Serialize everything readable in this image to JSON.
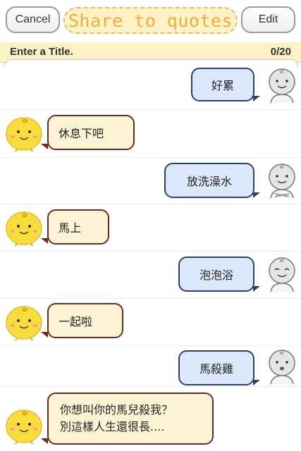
{
  "header": {
    "cancel_label": "Cancel",
    "title": "Share to quotes",
    "edit_label": "Edit"
  },
  "title_bar": {
    "label": "Enter a Title.",
    "counter": "0/20"
  },
  "messages": [
    {
      "sender": "user",
      "text": "好累"
    },
    {
      "sender": "bot",
      "text": "休息下吧"
    },
    {
      "sender": "user",
      "text": "放洗澡水"
    },
    {
      "sender": "bot",
      "text": "馬上"
    },
    {
      "sender": "user",
      "text": "泡泡浴"
    },
    {
      "sender": "bot",
      "text": "一起啦"
    },
    {
      "sender": "user",
      "text": "馬殺雞"
    },
    {
      "sender": "bot",
      "text": "你想叫你的馬兒殺我？\n別這樣人生還很長...."
    }
  ],
  "colors": {
    "title_text": "#f7ab3e",
    "title_bg": "#fff3c6",
    "user_bubble": "#dbe8fb",
    "bot_bubble": "#fef3d5",
    "bot_avatar": "#f8dc3c"
  },
  "icons": {
    "user_avatar": "gray-doodle-face-icon",
    "bot_avatar": "yellow-chick-icon"
  }
}
